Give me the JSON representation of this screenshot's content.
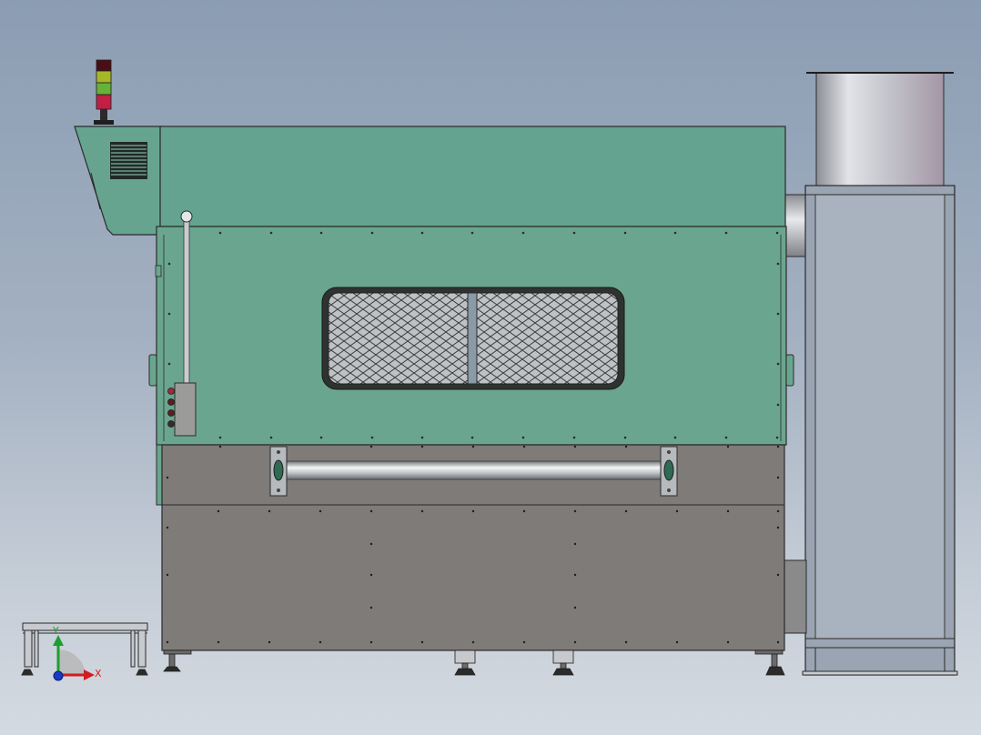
{
  "view": {
    "title": "",
    "background": "#9aa9bc"
  },
  "colors": {
    "upper_panel": "#66a490",
    "lower_panel": "#7e7b78",
    "outline": "#2b2b2b",
    "duct": "#b9b9bf",
    "cabinet_side": "#9ea7b4"
  },
  "signal_tower": {
    "lights": [
      "red",
      "yellow",
      "green",
      "dark-red"
    ]
  },
  "triad": {
    "x_label": "X",
    "y_label": "Y"
  },
  "icons": [
    "signal-tower-icon",
    "vent-grille-icon",
    "viewing-window-icon",
    "coordinate-triad-icon"
  ]
}
